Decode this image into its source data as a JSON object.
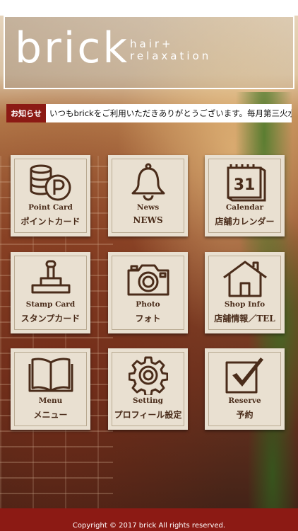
{
  "header": {
    "logo_main": "brick",
    "logo_sub_1": "hair+",
    "logo_sub_2": "relaxation"
  },
  "ticker": {
    "label": "お知らせ",
    "text": "いつもbrickをご利用いただきありがとうございます。毎月第三火水連休を頂"
  },
  "tiles": [
    {
      "en": "Point Card",
      "ja": "ポイントカード",
      "icon": "coins-icon"
    },
    {
      "en": "News",
      "ja": "NEWS",
      "icon": "bell-icon"
    },
    {
      "en": "Calendar",
      "ja": "店舗カレンダー",
      "icon": "calendar-icon",
      "calendar_day": "31"
    },
    {
      "en": "Stamp Card",
      "ja": "スタンプカード",
      "icon": "stamp-icon"
    },
    {
      "en": "Photo",
      "ja": "フォト",
      "icon": "camera-icon"
    },
    {
      "en": "Shop Info",
      "ja": "店舗情報／TEL",
      "icon": "house-icon"
    },
    {
      "en": "Menu",
      "ja": "メニュー",
      "icon": "book-icon"
    },
    {
      "en": "Setting",
      "ja": "プロフィール設定",
      "icon": "gear-icon"
    },
    {
      "en": "Reserve",
      "ja": "予約",
      "icon": "checkbox-icon"
    }
  ],
  "footer": {
    "copyright": "Copyright © 2017 brick All rights reserved."
  },
  "colors": {
    "accent": "#8c1a14",
    "tile_bg": "#e9e0d1",
    "icon": "#4a2c1a"
  }
}
